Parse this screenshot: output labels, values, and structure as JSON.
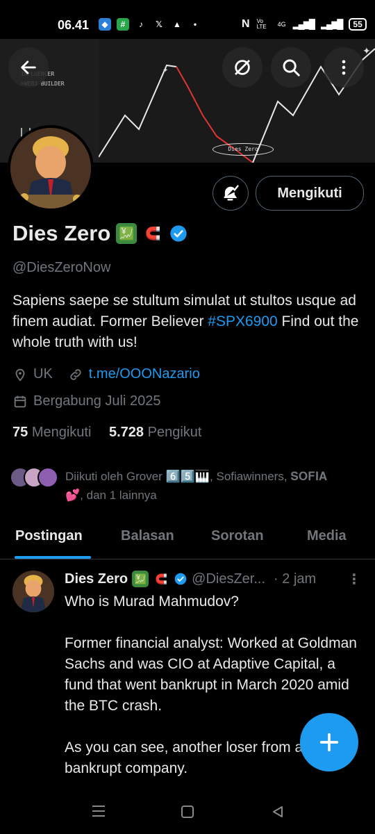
{
  "status_bar": {
    "time": "06.41",
    "network_label": "4G",
    "volte_label": "Vo LTE",
    "battery": "55"
  },
  "banner": {
    "line1": "INFLUENCER",
    "line2": ">WEB3 BUILDER",
    "signature": "Dies Zero"
  },
  "profile": {
    "follow_button": "Mengikuti",
    "display_name": "Dies Zero",
    "name_emojis": [
      "💹",
      "🧲"
    ],
    "handle": "@DiesZeroNow",
    "bio_part1": "Sapiens saepe se stultum simulat ut stultos usque ad finem audiat.  Former Believer ",
    "bio_hashtag": "#SPX6900",
    "bio_part2": " Find out the whole truth with us!",
    "location": "UK",
    "link": "t.me/OOONazario",
    "joined": "Bergabung Juli 2025",
    "following_count": "75",
    "following_label": "Mengikuti",
    "followers_count": "5.728",
    "followers_label": "Pengikut",
    "followed_by": "Diikuti oleh Grover 6️⃣5️⃣🎹, Sofiawinners, 𝐒𝐎𝐅𝐈𝐀 💕, dan 1 lainnya"
  },
  "tabs": [
    "Postingan",
    "Balasan",
    "Sorotan",
    "Media"
  ],
  "post": {
    "name": "Dies Zero",
    "emojis": [
      "💹",
      "🧲"
    ],
    "handle": "@DiesZer...",
    "time": "· 2 jam",
    "body": "Who is Murad Mahmudov?\n\nFormer financial analyst: Worked at Goldman Sachs and was CIO at Adaptive Capital, a fund that went bankrupt in March 2020 amid the BTC crash.\n\nAs you can see, another loser from a bankrupt company."
  },
  "colors": {
    "accent": "#1d9bf0",
    "text": "#e7e9ea",
    "muted": "#71767b",
    "background": "#000000"
  },
  "icons": [
    "back-arrow-icon",
    "unfollow-circle-icon",
    "search-icon",
    "more-vertical-icon",
    "bell-check-icon",
    "location-pin-icon",
    "link-icon",
    "calendar-icon",
    "verified-badge-icon",
    "plus-icon"
  ]
}
